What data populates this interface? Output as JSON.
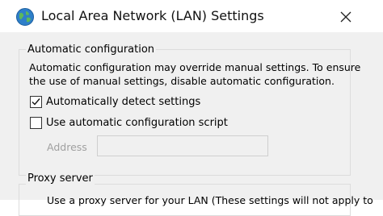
{
  "window": {
    "title": "Local Area Network (LAN) Settings",
    "icon": "network-globe-icon",
    "close_glyph": "✕"
  },
  "auto_config": {
    "group_label": "Automatic configuration",
    "description_line1": "Automatic configuration may override manual settings.  To ensure",
    "description_line2": "the use of manual settings, disable automatic configuration.",
    "detect_label": "Automatically detect settings",
    "detect_checked": true,
    "script_label": "Use automatic configuration script",
    "script_checked": false,
    "address_label": "Address",
    "address_value": ""
  },
  "proxy": {
    "group_label": "Proxy server",
    "partial_line": "Use a proxy server for your LAN (These settings will not apply to"
  }
}
